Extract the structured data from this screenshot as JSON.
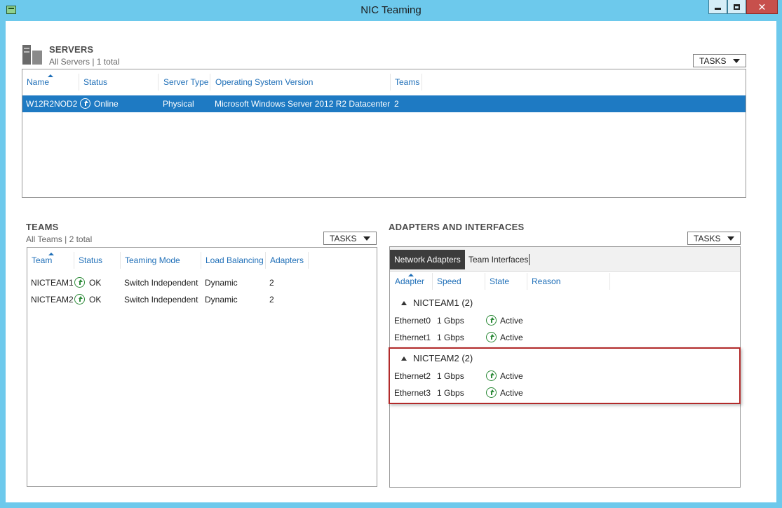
{
  "window": {
    "title": "NIC Teaming"
  },
  "servers": {
    "title": "SERVERS",
    "subtitle": "All Servers | 1 total",
    "tasks_label": "TASKS",
    "columns": [
      "Name",
      "Status",
      "Server Type",
      "Operating System Version",
      "Teams"
    ],
    "rows": [
      {
        "name": "W12R2NOD2",
        "status": "Online",
        "server_type": "Physical",
        "os": "Microsoft Windows Server 2012 R2 Datacenter",
        "teams": "2"
      }
    ]
  },
  "teams": {
    "title": "TEAMS",
    "subtitle": "All Teams | 2 total",
    "tasks_label": "TASKS",
    "columns": [
      "Team",
      "Status",
      "Teaming Mode",
      "Load Balancing",
      "Adapters"
    ],
    "rows": [
      {
        "team": "NICTEAM1",
        "status": "OK",
        "mode": "Switch Independent",
        "lb": "Dynamic",
        "adapters": "2"
      },
      {
        "team": "NICTEAM2",
        "status": "OK",
        "mode": "Switch Independent",
        "lb": "Dynamic",
        "adapters": "2"
      }
    ]
  },
  "adapters": {
    "title": "ADAPTERS AND INTERFACES",
    "tasks_label": "TASKS",
    "tabs": [
      "Network Adapters",
      "Team Interfaces"
    ],
    "columns": [
      "Adapter",
      "Speed",
      "State",
      "Reason"
    ],
    "groups": [
      {
        "label": "NICTEAM1 (2)",
        "rows": [
          {
            "adapter": "Ethernet0",
            "speed": "1 Gbps",
            "state": "Active"
          },
          {
            "adapter": "Ethernet1",
            "speed": "1 Gbps",
            "state": "Active"
          }
        ]
      },
      {
        "label": "NICTEAM2 (2)",
        "rows": [
          {
            "adapter": "Ethernet2",
            "speed": "1 Gbps",
            "state": "Active"
          },
          {
            "adapter": "Ethernet3",
            "speed": "1 Gbps",
            "state": "Active"
          }
        ]
      }
    ]
  },
  "colors": {
    "accent": "#1e7ac3",
    "status_ok": "#2e8b3a",
    "highlight": "#b22a2a"
  },
  "icons": {
    "status": "up-arrow-circle-icon",
    "servers": "server-icon"
  }
}
